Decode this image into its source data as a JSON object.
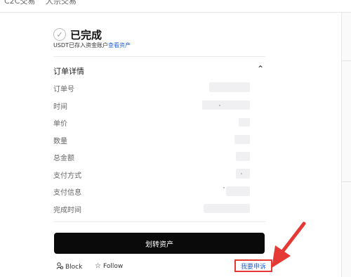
{
  "nav": {
    "tabs": [
      {
        "label": "C2C交易"
      },
      {
        "label": "大宗交易"
      }
    ]
  },
  "order": {
    "status_title": "已完成",
    "status_prefix": "USDT已存入资金账户",
    "status_link": "查看资产",
    "section_title": "订单详情",
    "labels": {
      "order_no": "订单号",
      "time": "时间",
      "unit_price": "单价",
      "quantity": "数量",
      "total": "总金额",
      "payment_method": "支付方式",
      "payment_info": "支付信息",
      "complete_time": "完成时间"
    }
  },
  "actions": {
    "transfer_button": "划转资产",
    "block_label": "Block",
    "follow_label": "Follow",
    "appeal_link": "我要申诉"
  },
  "colors": {
    "accent_link": "#2a63d8",
    "highlight_red": "#e53935",
    "button_black": "#0a0a0a"
  },
  "icons": {
    "check": "check-circle-icon",
    "collapse": "chevron-up-icon",
    "block": "user-block-icon",
    "follow": "star-icon"
  }
}
